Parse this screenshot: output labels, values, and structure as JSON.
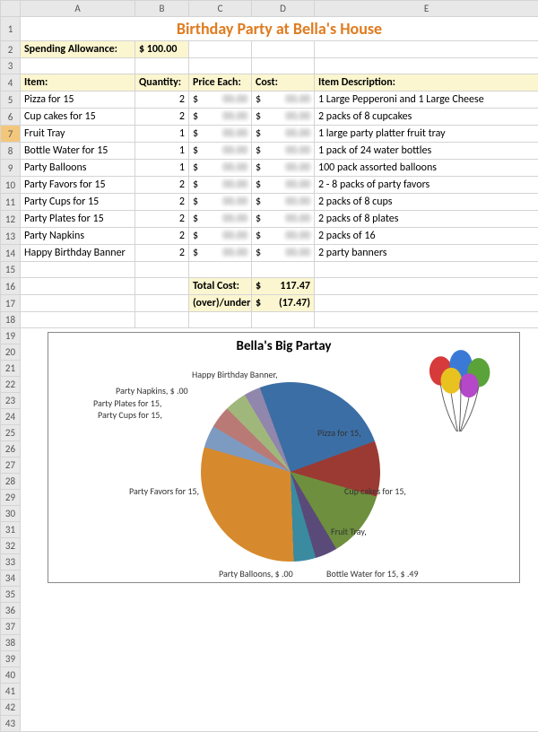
{
  "columns": [
    "",
    "A",
    "B",
    "C",
    "D",
    "E"
  ],
  "rows_visible": 43,
  "title": "Birthday Party at Bella's House",
  "allowance_label": "Spending Allowance:",
  "allowance_value": "$ 100.00",
  "headers": {
    "item": "Item:",
    "qty": "Quantity:",
    "price": "Price Each:",
    "cost": "Cost:",
    "desc": "Item Description:"
  },
  "items": [
    {
      "item": "Pizza for 15",
      "qty": "2",
      "price": "$",
      "cost": "$",
      "desc": "1 Large Pepperoni and 1 Large Cheese"
    },
    {
      "item": "Cup cakes for 15",
      "qty": "2",
      "price": "$",
      "cost": "$",
      "desc": "2 packs of 8 cupcakes"
    },
    {
      "item": "Fruit Tray",
      "qty": "1",
      "price": "$",
      "cost": "$",
      "desc": "1 large party platter fruit tray"
    },
    {
      "item": "Bottle Water for 15",
      "qty": "1",
      "price": "$",
      "cost": "$",
      "desc": "1 pack of 24 water bottles"
    },
    {
      "item": "Party Balloons",
      "qty": "1",
      "price": "$",
      "cost": "$",
      "desc": "100 pack assorted balloons"
    },
    {
      "item": "Party Favors for 15",
      "qty": "2",
      "price": "$",
      "cost": "$",
      "desc": "2 - 8 packs of party favors"
    },
    {
      "item": "Party Cups for 15",
      "qty": "2",
      "price": "$",
      "cost": "$",
      "desc": "2 packs of 8 cups"
    },
    {
      "item": "Party Plates for 15",
      "qty": "2",
      "price": "$",
      "cost": "$",
      "desc": "2 packs of 8 plates"
    },
    {
      "item": "Party Napkins",
      "qty": "2",
      "price": "$",
      "cost": "$",
      "desc": "2 packs of 16"
    },
    {
      "item": "Happy Birthday Banner",
      "qty": "2",
      "price": "$",
      "cost": "$",
      "desc": "2 party banners"
    }
  ],
  "totals": {
    "total_label": "Total Cost:",
    "total_value": "$   117.47",
    "over_label": "(over)/under",
    "over_value": "$   (17.47)"
  },
  "chart_data": {
    "type": "pie",
    "title": "Bella's Big Partay",
    "series": [
      {
        "name": "Pizza for 15",
        "value": 25,
        "color": "#3b6ea5",
        "label": "Pizza for 15,"
      },
      {
        "name": "Cup cakes for 15",
        "value": 10,
        "color": "#9b3a32",
        "label": "Cup cakes for 15,"
      },
      {
        "name": "Fruit Tray",
        "value": 12,
        "color": "#6e8f3e",
        "label": "Fruit Tray,"
      },
      {
        "name": "Bottle Water for 15",
        "value": 4,
        "color": "#5a4a7a",
        "label": "Bottle Water for 15, $  .49"
      },
      {
        "name": "Party Balloons",
        "value": 4,
        "color": "#3a8aa0",
        "label": "Party Balloons, $  .00"
      },
      {
        "name": "Party Favors for 15",
        "value": 30,
        "color": "#d68a2d",
        "label": "Party Favors for 15,"
      },
      {
        "name": "Party Cups for 15",
        "value": 4,
        "color": "#7d9bc1",
        "label": "Party Cups for 15,"
      },
      {
        "name": "Party Plates for 15",
        "value": 4,
        "color": "#b97a76",
        "label": "Party Plates for 15,"
      },
      {
        "name": "Party Napkins",
        "value": 4,
        "color": "#a0b77c",
        "label": "Party Napkins, $  .00"
      },
      {
        "name": "Happy Birthday Banner",
        "value": 3,
        "color": "#9186ac",
        "label": "Happy Birthday Banner,"
      }
    ]
  },
  "selected_row": 7
}
